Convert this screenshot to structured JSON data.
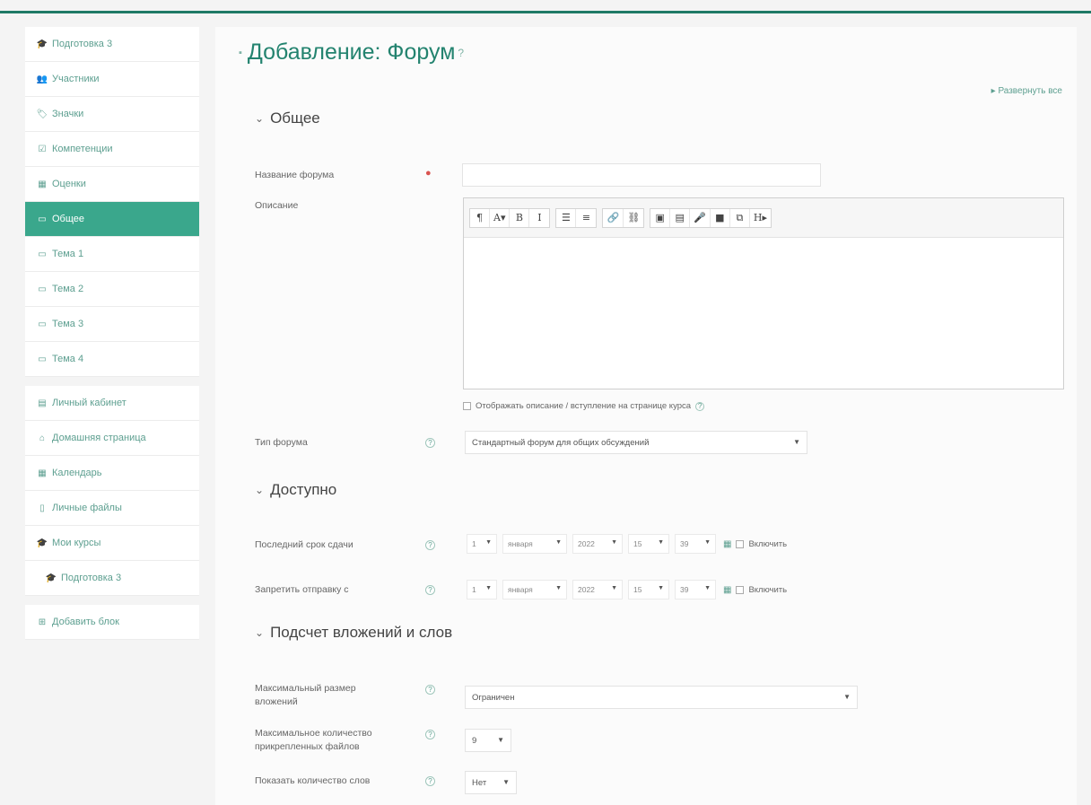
{
  "sidebar": {
    "groups": [
      [
        {
          "icon": "graduation-cap",
          "glyph": "🎓",
          "label": "Подготовка 3"
        },
        {
          "icon": "users",
          "glyph": "👥",
          "label": "Участники"
        },
        {
          "icon": "badge",
          "glyph": "🏷",
          "label": "Значки"
        },
        {
          "icon": "check-square",
          "glyph": "☑",
          "label": "Компетенции"
        },
        {
          "icon": "table",
          "glyph": "▦",
          "label": "Оценки"
        },
        {
          "icon": "folder",
          "glyph": "▭",
          "label": "Общее",
          "active": true
        },
        {
          "icon": "folder",
          "glyph": "▭",
          "label": "Тема 1"
        },
        {
          "icon": "folder",
          "glyph": "▭",
          "label": "Тема 2"
        },
        {
          "icon": "folder",
          "glyph": "▭",
          "label": "Тема 3"
        },
        {
          "icon": "folder",
          "glyph": "▭",
          "label": "Тема 4"
        }
      ],
      [
        {
          "icon": "dashboard",
          "glyph": "▤",
          "label": "Личный кабинет"
        },
        {
          "icon": "home",
          "glyph": "⌂",
          "label": "Домашняя страница"
        },
        {
          "icon": "calendar",
          "glyph": "▦",
          "label": "Календарь"
        },
        {
          "icon": "file",
          "glyph": "▯",
          "label": "Личные файлы"
        },
        {
          "icon": "graduation-cap",
          "glyph": "🎓",
          "label": "Мои курсы"
        },
        {
          "icon": "graduation-cap",
          "glyph": "🎓",
          "label": "Подготовка 3",
          "indent": true
        }
      ],
      [
        {
          "icon": "plus-square",
          "glyph": "⊞",
          "label": "Добавить блок"
        }
      ]
    ]
  },
  "page": {
    "title": "Добавление: Форум",
    "expand_all": "▸ Развернуть все"
  },
  "sections": {
    "general": "Общее",
    "availability": "Доступно",
    "attachments": "Подсчет вложений и слов"
  },
  "form": {
    "forum_name_label": "Название форума",
    "description_label": "Описание",
    "show_description_label": "Отображать описание / вступление на странице курса",
    "forum_type_label": "Тип форума",
    "forum_type_value": "Стандартный форум для общих обсуждений",
    "due_date_label": "Последний срок сдачи",
    "cutoff_label": "Запретить отправку с",
    "enable_label": "Включить",
    "max_attachment_size_label": "Максимальный размер вложений",
    "max_attachment_size_value": "Ограничен",
    "max_attachments_label": "Максимальное количество прикрепленных файлов",
    "max_attachments_value": "9",
    "word_count_label": "Показать количество слов",
    "word_count_value": "Нет"
  },
  "dates": {
    "due": {
      "day": "1",
      "month": "января",
      "year": "2022",
      "hour": "15",
      "minute": "39"
    },
    "cutoff": {
      "day": "1",
      "month": "января",
      "year": "2022",
      "hour": "15",
      "minute": "39"
    }
  },
  "toolbar": {
    "groups": [
      [
        {
          "name": "paragraph-button",
          "glyph": "¶"
        },
        {
          "name": "font-style-button",
          "glyph": "A▾"
        },
        {
          "name": "bold-button",
          "glyph": "B"
        },
        {
          "name": "italic-button",
          "glyph": "I"
        }
      ],
      [
        {
          "name": "unordered-list-button",
          "glyph": "☰"
        },
        {
          "name": "ordered-list-button",
          "glyph": "≡"
        }
      ],
      [
        {
          "name": "link-button",
          "glyph": "🔗"
        },
        {
          "name": "unlink-button",
          "glyph": "⛓"
        }
      ],
      [
        {
          "name": "image-button",
          "glyph": "▣"
        },
        {
          "name": "media-button",
          "glyph": "▤"
        },
        {
          "name": "audio-button",
          "glyph": "🎤"
        },
        {
          "name": "video-button",
          "glyph": "■"
        },
        {
          "name": "file-button",
          "glyph": "⧉"
        },
        {
          "name": "h5p-button",
          "glyph": "H▸"
        }
      ]
    ]
  }
}
